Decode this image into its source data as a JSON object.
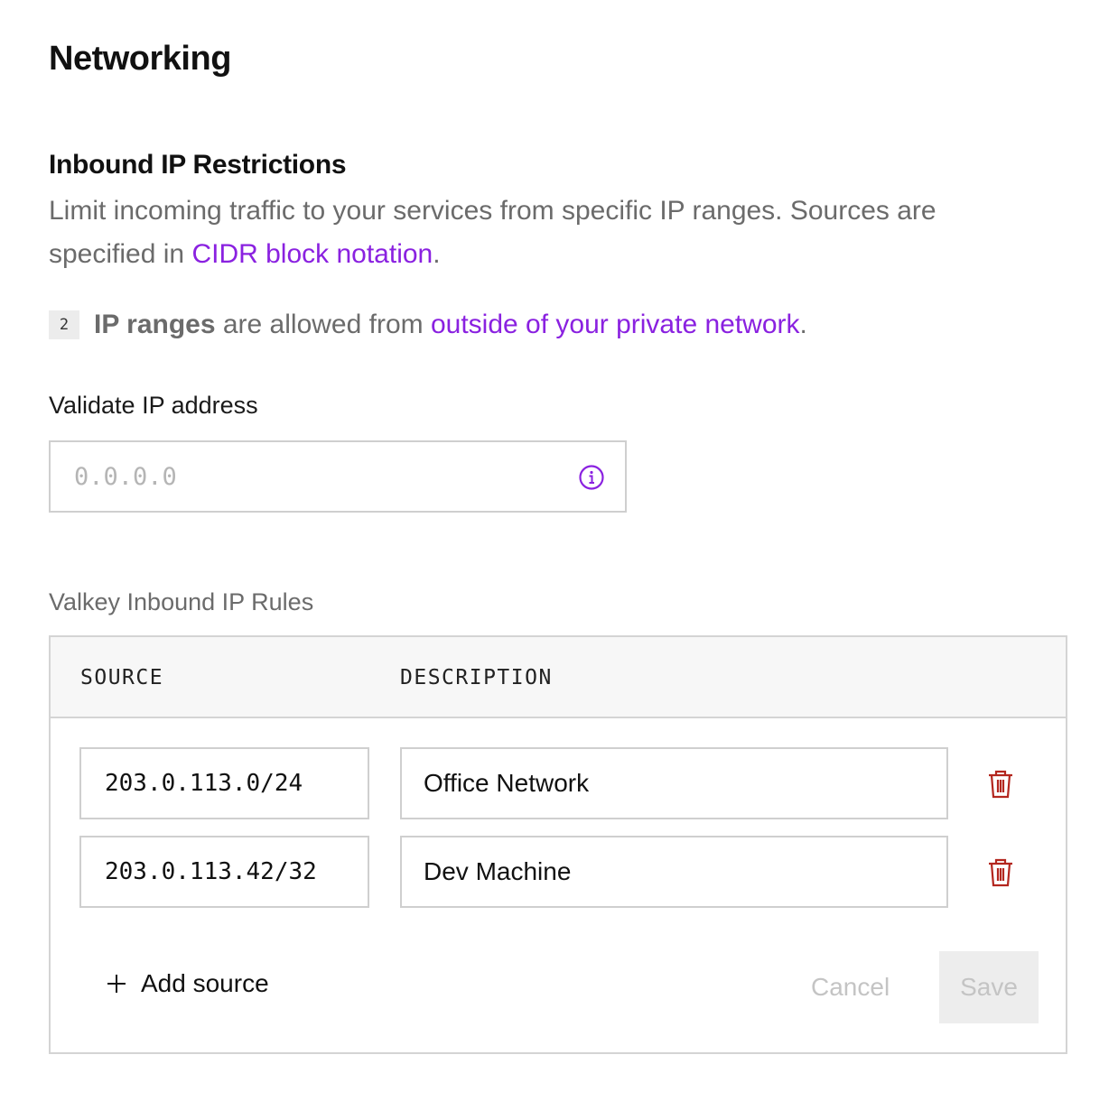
{
  "page": {
    "title": "Networking"
  },
  "inbound": {
    "title": "Inbound IP Restrictions",
    "desc_text": "Limit incoming traffic to your services from specific IP ranges. Sources are specified in ",
    "desc_link": "CIDR block notation",
    "desc_end": "."
  },
  "range_summary": {
    "count": "2",
    "strong": "IP ranges",
    "middle": " are allowed from ",
    "link": "outside of your private network",
    "end": "."
  },
  "validate": {
    "label": "Validate IP address",
    "placeholder": "0.0.0.0",
    "value": ""
  },
  "rules": {
    "label": "Valkey Inbound IP Rules",
    "columns": {
      "source": "SOURCE",
      "description": "DESCRIPTION"
    },
    "rows": [
      {
        "source": "203.0.113.0/24",
        "description": "Office Network"
      },
      {
        "source": "203.0.113.42/32",
        "description": "Dev Machine"
      }
    ],
    "add_label": "Add source",
    "cancel_label": "Cancel",
    "save_label": "Save"
  },
  "colors": {
    "link": "#8a21e0",
    "delete": "#b3261e",
    "muted_text": "#6b6b6b",
    "disabled": "#c4c4c4"
  },
  "icons": {
    "info": "info-icon",
    "delete": "trash-icon",
    "add": "plus-icon"
  }
}
